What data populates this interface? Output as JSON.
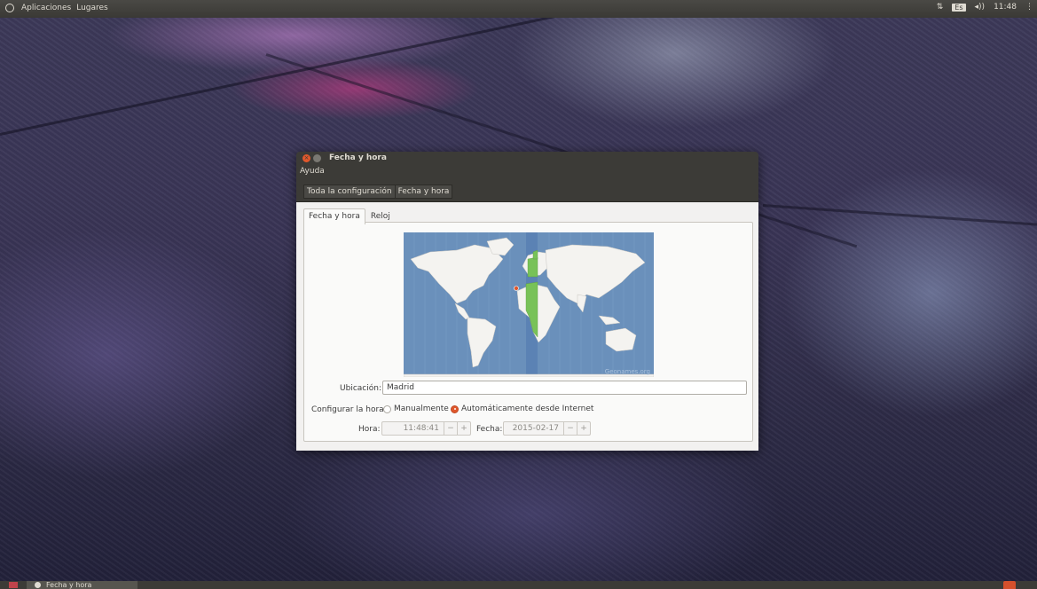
{
  "top_panel": {
    "menu_apps": "Aplicaciones",
    "menu_places": "Lugares",
    "keyboard_layout": "Es",
    "clock": "11:48"
  },
  "window": {
    "title": "Fecha y hora",
    "menu_help": "Ayuda",
    "breadcrumb": [
      "Toda la configuración",
      "Fecha y hora"
    ],
    "tabs": [
      "Fecha y hora",
      "Reloj"
    ],
    "map_watermark": "Geonames.org",
    "location_label": "Ubicación:",
    "location_value": "Madrid",
    "config_label": "Configurar la hora:",
    "radio_manual": "Manualmente",
    "radio_auto": "Automáticamente desde Internet",
    "time_label": "Hora:",
    "time_value": "11:48:41",
    "date_label": "Fecha:",
    "date_value": "2015-02-17",
    "minus": "−",
    "plus": "+"
  },
  "taskbar": {
    "task_label": "Fecha y hora"
  },
  "colors": {
    "accent": "#e0572c",
    "panel": "#3c3b37",
    "timezone_band": "#78c258",
    "ocean": "#6a90bb"
  }
}
